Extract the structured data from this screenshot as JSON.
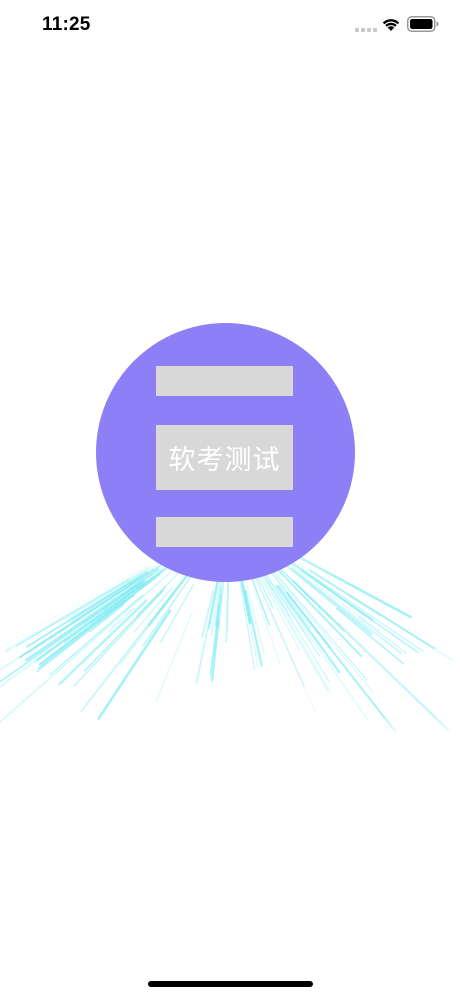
{
  "status_bar": {
    "time": "11:25",
    "icons": [
      "cellular-signal-icon",
      "wifi-icon",
      "battery-icon"
    ]
  },
  "splash": {
    "logo_text": "软考测试",
    "circle_color": "#8d7ff5",
    "bar_color": "#d8d8d8",
    "burst_color": "#5ee6ef"
  }
}
